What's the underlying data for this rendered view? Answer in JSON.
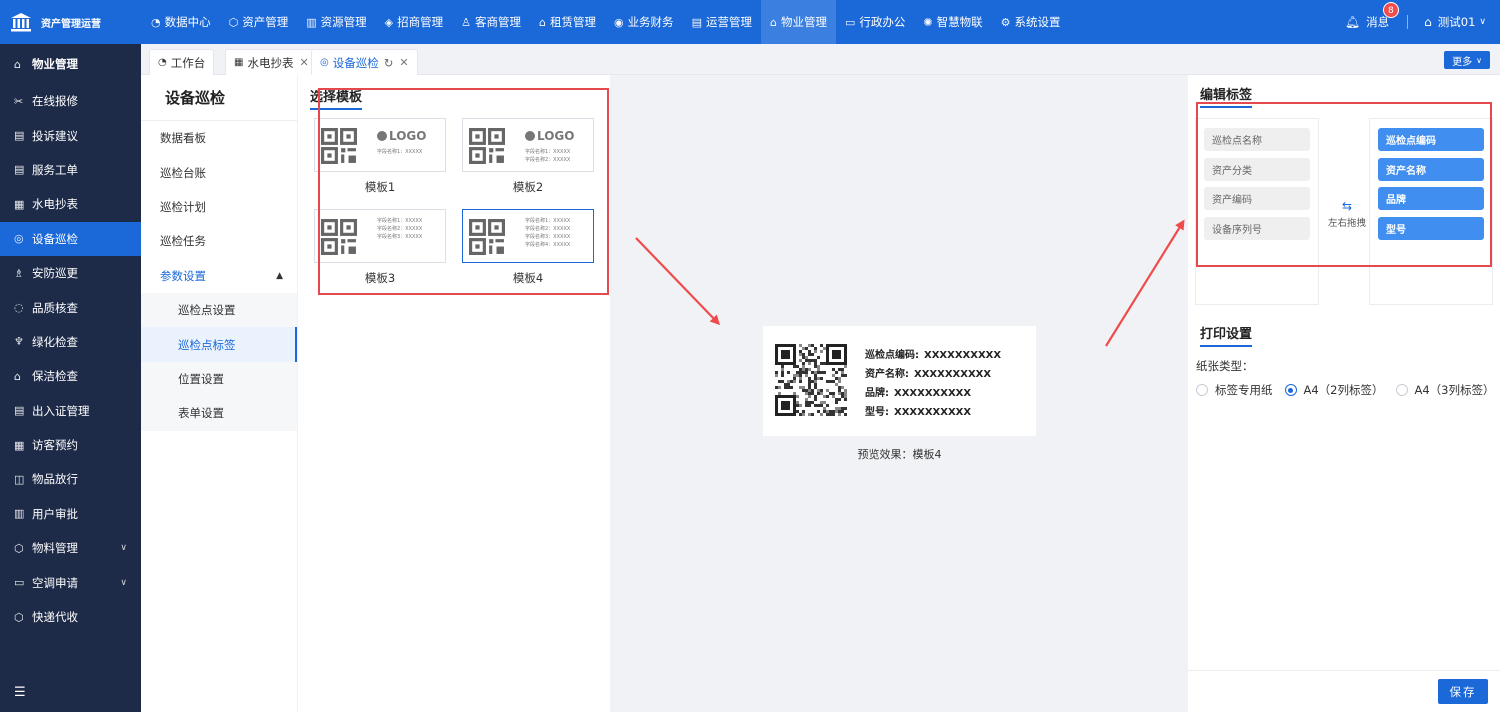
{
  "app": {
    "title": "资产管理运营"
  },
  "topnav": [
    {
      "label": "数据中心",
      "icon": "dashboard-icon",
      "glyph": "◔"
    },
    {
      "label": "资产管理",
      "icon": "cube-icon",
      "glyph": "⬡"
    },
    {
      "label": "资源管理",
      "icon": "building-icon",
      "glyph": "▥"
    },
    {
      "label": "招商管理",
      "icon": "tag-icon",
      "glyph": "◈"
    },
    {
      "label": "客商管理",
      "icon": "users-icon",
      "glyph": "♙"
    },
    {
      "label": "租赁管理",
      "icon": "house-icon",
      "glyph": "⌂"
    },
    {
      "label": "业务财务",
      "icon": "coin-icon",
      "glyph": "◉"
    },
    {
      "label": "运营管理",
      "icon": "chart-icon",
      "glyph": "▤"
    },
    {
      "label": "物业管理",
      "icon": "home-icon",
      "glyph": "⌂",
      "active": true
    },
    {
      "label": "行政办公",
      "icon": "monitor-icon",
      "glyph": "▭"
    },
    {
      "label": "智慧物联",
      "icon": "iot-icon",
      "glyph": "✺"
    },
    {
      "label": "系统设置",
      "icon": "gear-icon",
      "glyph": "⚙"
    }
  ],
  "header": {
    "messages_label": "消息",
    "messages_count": "8",
    "user_name": "测试01"
  },
  "sidebar": {
    "title": "物业管理",
    "items": [
      {
        "label": "在线报修",
        "glyph": "✂"
      },
      {
        "label": "投诉建议",
        "glyph": "▤"
      },
      {
        "label": "服务工单",
        "glyph": "▤"
      },
      {
        "label": "水电抄表",
        "glyph": "▦"
      },
      {
        "label": "设备巡检",
        "glyph": "◎",
        "active": true
      },
      {
        "label": "安防巡更",
        "glyph": "♗"
      },
      {
        "label": "品质核查",
        "glyph": "◌"
      },
      {
        "label": "绿化检查",
        "glyph": "♆"
      },
      {
        "label": "保洁检查",
        "glyph": "⌂"
      },
      {
        "label": "出入证管理",
        "glyph": "▤"
      },
      {
        "label": "访客预约",
        "glyph": "▦"
      },
      {
        "label": "物品放行",
        "glyph": "◫"
      },
      {
        "label": "用户审批",
        "glyph": "▥"
      },
      {
        "label": "物料管理",
        "glyph": "⬡",
        "chevron": true
      },
      {
        "label": "空调申请",
        "glyph": "▭",
        "chevron": true
      },
      {
        "label": "快递代收",
        "glyph": "⬡"
      }
    ]
  },
  "tabs": [
    {
      "label": "工作台",
      "glyph": "◔"
    },
    {
      "label": "水电抄表",
      "glyph": "▦"
    },
    {
      "label": "设备巡检",
      "glyph": "◎",
      "active": true
    }
  ],
  "tabs_more": "更多",
  "submenu": {
    "title": "设备巡检",
    "items": [
      "数据看板",
      "巡检台账",
      "巡检计划",
      "巡检任务"
    ],
    "group": "参数设置",
    "subitems": [
      "巡检点设置",
      "巡检点标签",
      "位置设置",
      "表单设置"
    ]
  },
  "templates": {
    "title": "选择模板",
    "logo_text": "LOGO",
    "items": [
      {
        "label": "模板1",
        "lines": [
          "字段名称1：XXXXX"
        ]
      },
      {
        "label": "模板2",
        "lines": [
          "字段名称1：XXXXX",
          "字段名称2：XXXXX"
        ]
      },
      {
        "label": "模板3",
        "lines": [
          "字段名称1：XXXXX",
          "字段名称2：XXXXX",
          "字段名称3：XXXXX"
        ]
      },
      {
        "label": "模板4",
        "lines": [
          "字段名称1：XXXXX",
          "字段名称2：XXXXX",
          "字段名称3：XXXXX",
          "字段名称4：XXXXX"
        ],
        "selected": true
      }
    ]
  },
  "preview": {
    "lines": [
      {
        "key": "巡检点编码:",
        "value": "XXXXXXXXXX"
      },
      {
        "key": "资产名称:",
        "value": "XXXXXXXXXX"
      },
      {
        "key": "品牌:",
        "value": "XXXXXXXXXX"
      },
      {
        "key": "型号:",
        "value": "XXXXXXXXXX"
      }
    ],
    "caption": "预览效果：模板4"
  },
  "edit_tags": {
    "title": "编辑标签",
    "available": [
      "巡检点名称",
      "资产分类",
      "资产编码",
      "设备序列号"
    ],
    "selected": [
      "巡检点编码",
      "资产名称",
      "品牌",
      "型号"
    ],
    "swap_label": "左右拖拽"
  },
  "print": {
    "title": "打印设置",
    "paper_label": "纸张类型：",
    "options": [
      {
        "label": "标签专用纸",
        "checked": false
      },
      {
        "label": "A4（2列标签）",
        "checked": true
      },
      {
        "label": "A4（3列标签）",
        "checked": false
      }
    ]
  },
  "save_label": "保存",
  "colors": {
    "primary": "#1b68d8",
    "sidebar": "#1e2b48",
    "annotation": "#e5484d"
  }
}
